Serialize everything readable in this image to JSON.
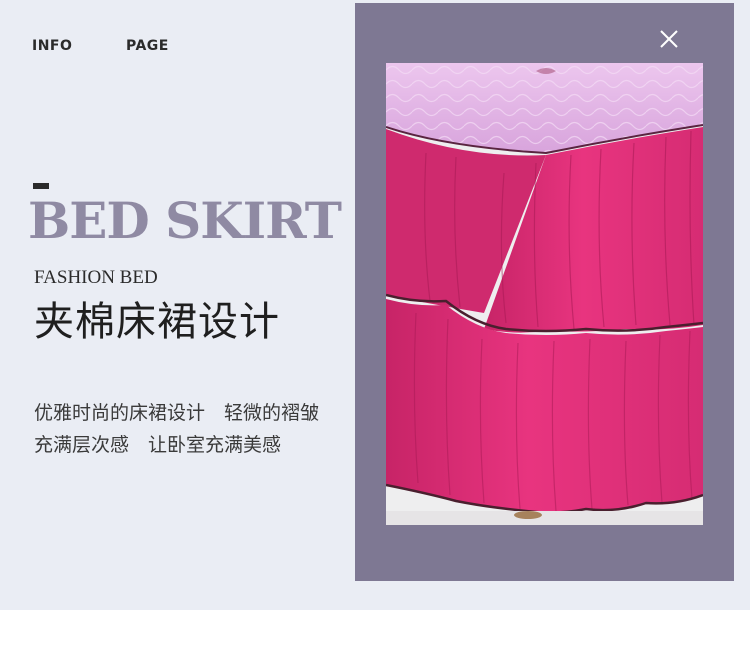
{
  "nav": {
    "info": "INFO",
    "page": "PAGE"
  },
  "hero": {
    "headline": "BED SKIRT",
    "subheading": "FASHION BED",
    "title_cn": "夹棉床裙设计",
    "desc_line_1": "优雅时尚的床裙设计　轻微的褶皱",
    "desc_line_2": "充满层次感　让卧室充满美感"
  },
  "colors": {
    "panel_bg": "#eaedf4",
    "frame_bg": "#7e7893",
    "headline": "#8f8aa3",
    "skirt_pink": "#e0337a",
    "quilt_pink": "#e2b6e6",
    "piping": "#4a1f2e"
  },
  "icons": {
    "close": "close-icon"
  }
}
